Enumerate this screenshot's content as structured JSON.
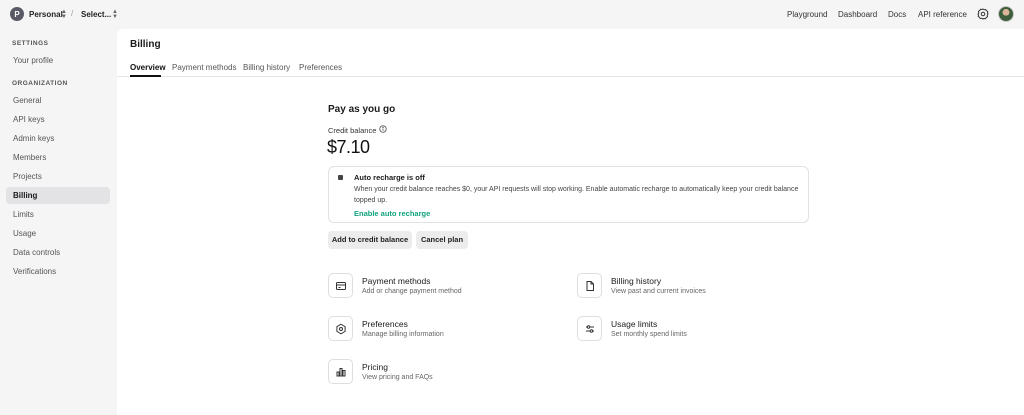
{
  "topbar": {
    "org_initial": "P",
    "org_name": "Personal",
    "separator": "/",
    "project_name": "Select...",
    "links": [
      "Playground",
      "Dashboard",
      "Docs",
      "API reference"
    ]
  },
  "sidebar": {
    "settings_heading": "SETTINGS",
    "settings_items": [
      "Your profile"
    ],
    "org_heading": "ORGANIZATION",
    "org_items": [
      "General",
      "API keys",
      "Admin keys",
      "Members",
      "Projects",
      "Billing",
      "Limits",
      "Usage",
      "Data controls",
      "Verifications"
    ],
    "active_item": "Billing"
  },
  "main": {
    "title": "Billing",
    "tabs": [
      "Overview",
      "Payment methods",
      "Billing history",
      "Preferences"
    ],
    "active_tab": "Overview",
    "section_title": "Pay as you go",
    "credit_label": "Credit balance",
    "credit_amount": "$7.10",
    "recharge": {
      "title": "Auto recharge is off",
      "text": "When your credit balance reaches $0, your API requests will stop working. Enable automatic recharge to automatically keep your credit balance topped up.",
      "link": "Enable auto recharge"
    },
    "buttons": {
      "add_credit": "Add to credit balance",
      "cancel_plan": "Cancel plan"
    },
    "cards": [
      {
        "title": "Payment methods",
        "subtitle": "Add or change payment method",
        "icon": "credit-card-icon"
      },
      {
        "title": "Billing history",
        "subtitle": "View past and current invoices",
        "icon": "document-icon"
      },
      {
        "title": "Preferences",
        "subtitle": "Manage billing information",
        "icon": "gear-icon"
      },
      {
        "title": "Usage limits",
        "subtitle": "Set monthly spend limits",
        "icon": "sliders-icon"
      },
      {
        "title": "Pricing",
        "subtitle": "View pricing and FAQs",
        "icon": "bar-chart-icon"
      }
    ]
  },
  "colors": {
    "accent_green": "#10a37f",
    "sidebar_bg": "#f5f5f5",
    "active_item_bg": "#e3e3e6"
  }
}
